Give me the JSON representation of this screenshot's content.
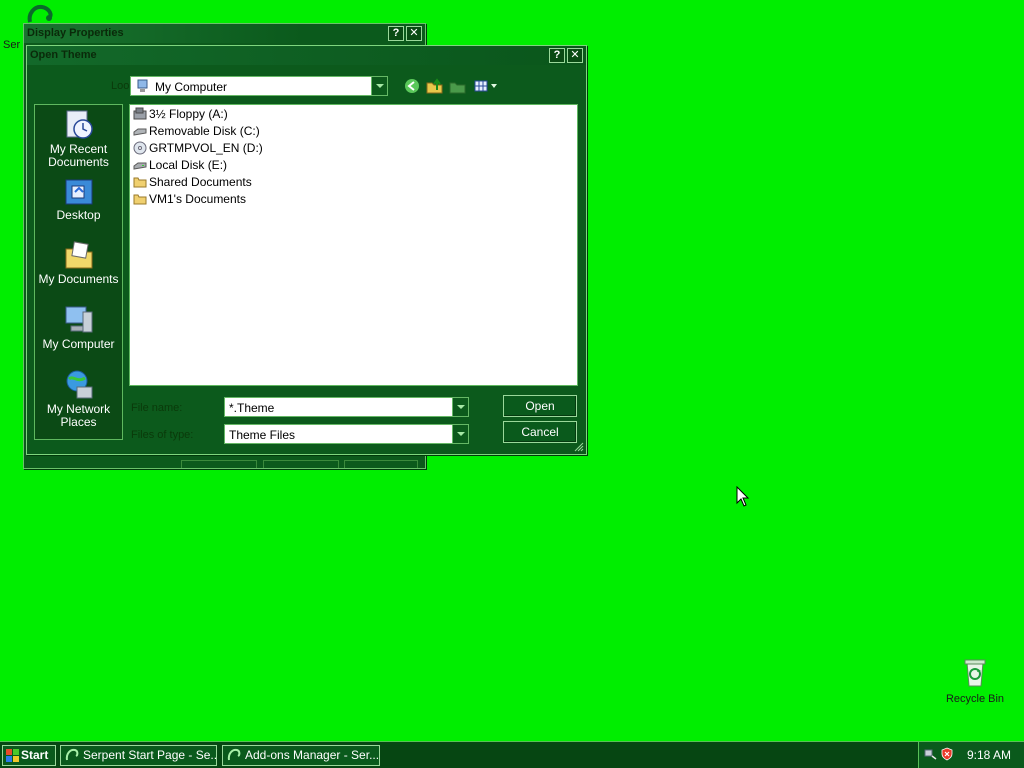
{
  "desktop": {
    "background": "#00ee00",
    "icons": [
      {
        "label": "Ser",
        "icon": "serpent-browser-icon"
      },
      {
        "label": "Recycle Bin",
        "icon": "recycle-bin-icon"
      }
    ]
  },
  "display_properties": {
    "title": "Display Properties",
    "help": "?",
    "close": "✕"
  },
  "open_theme": {
    "title": "Open Theme",
    "help": "?",
    "close": "✕",
    "look_in_label": "Look in:",
    "look_in_value": "My Computer",
    "toolbar": [
      "back-icon",
      "up-folder-icon",
      "new-folder-icon",
      "views-menu-icon"
    ],
    "places": [
      {
        "label": "My Recent Documents",
        "icon": "recent-documents-icon"
      },
      {
        "label": "Desktop",
        "icon": "desktop-icon"
      },
      {
        "label": "My Documents",
        "icon": "my-documents-icon"
      },
      {
        "label": "My Computer",
        "icon": "my-computer-icon"
      },
      {
        "label": "My Network Places",
        "icon": "network-places-icon"
      }
    ],
    "files": [
      {
        "label": "3½ Floppy (A:)",
        "icon": "floppy-drive-icon"
      },
      {
        "label": "Removable Disk (C:)",
        "icon": "removable-disk-icon"
      },
      {
        "label": "GRTMPVOL_EN (D:)",
        "icon": "cd-drive-icon"
      },
      {
        "label": "Local Disk (E:)",
        "icon": "hard-disk-icon"
      },
      {
        "label": "Shared Documents",
        "icon": "folder-icon"
      },
      {
        "label": "VM1's Documents",
        "icon": "folder-icon"
      }
    ],
    "file_name_label": "File name:",
    "file_name_value": "*.Theme",
    "file_type_label": "Files of type:",
    "file_type_value": "Theme Files",
    "open_button": "Open",
    "cancel_button": "Cancel"
  },
  "taskbar": {
    "start": "Start",
    "tasks": [
      {
        "label": "Serpent Start Page - Se...",
        "icon": "serpent-browser-icon"
      },
      {
        "label": "Add-ons Manager - Ser...",
        "icon": "serpent-browser-icon"
      }
    ],
    "tray_icons": [
      "network-tray-icon",
      "security-shield-icon"
    ],
    "clock": "9:18 AM"
  },
  "colors": {
    "window_body": "#0c5a1c",
    "window_border": "#6ac26a",
    "title_text": "#0a2a0a",
    "taskbar": "#064612"
  }
}
